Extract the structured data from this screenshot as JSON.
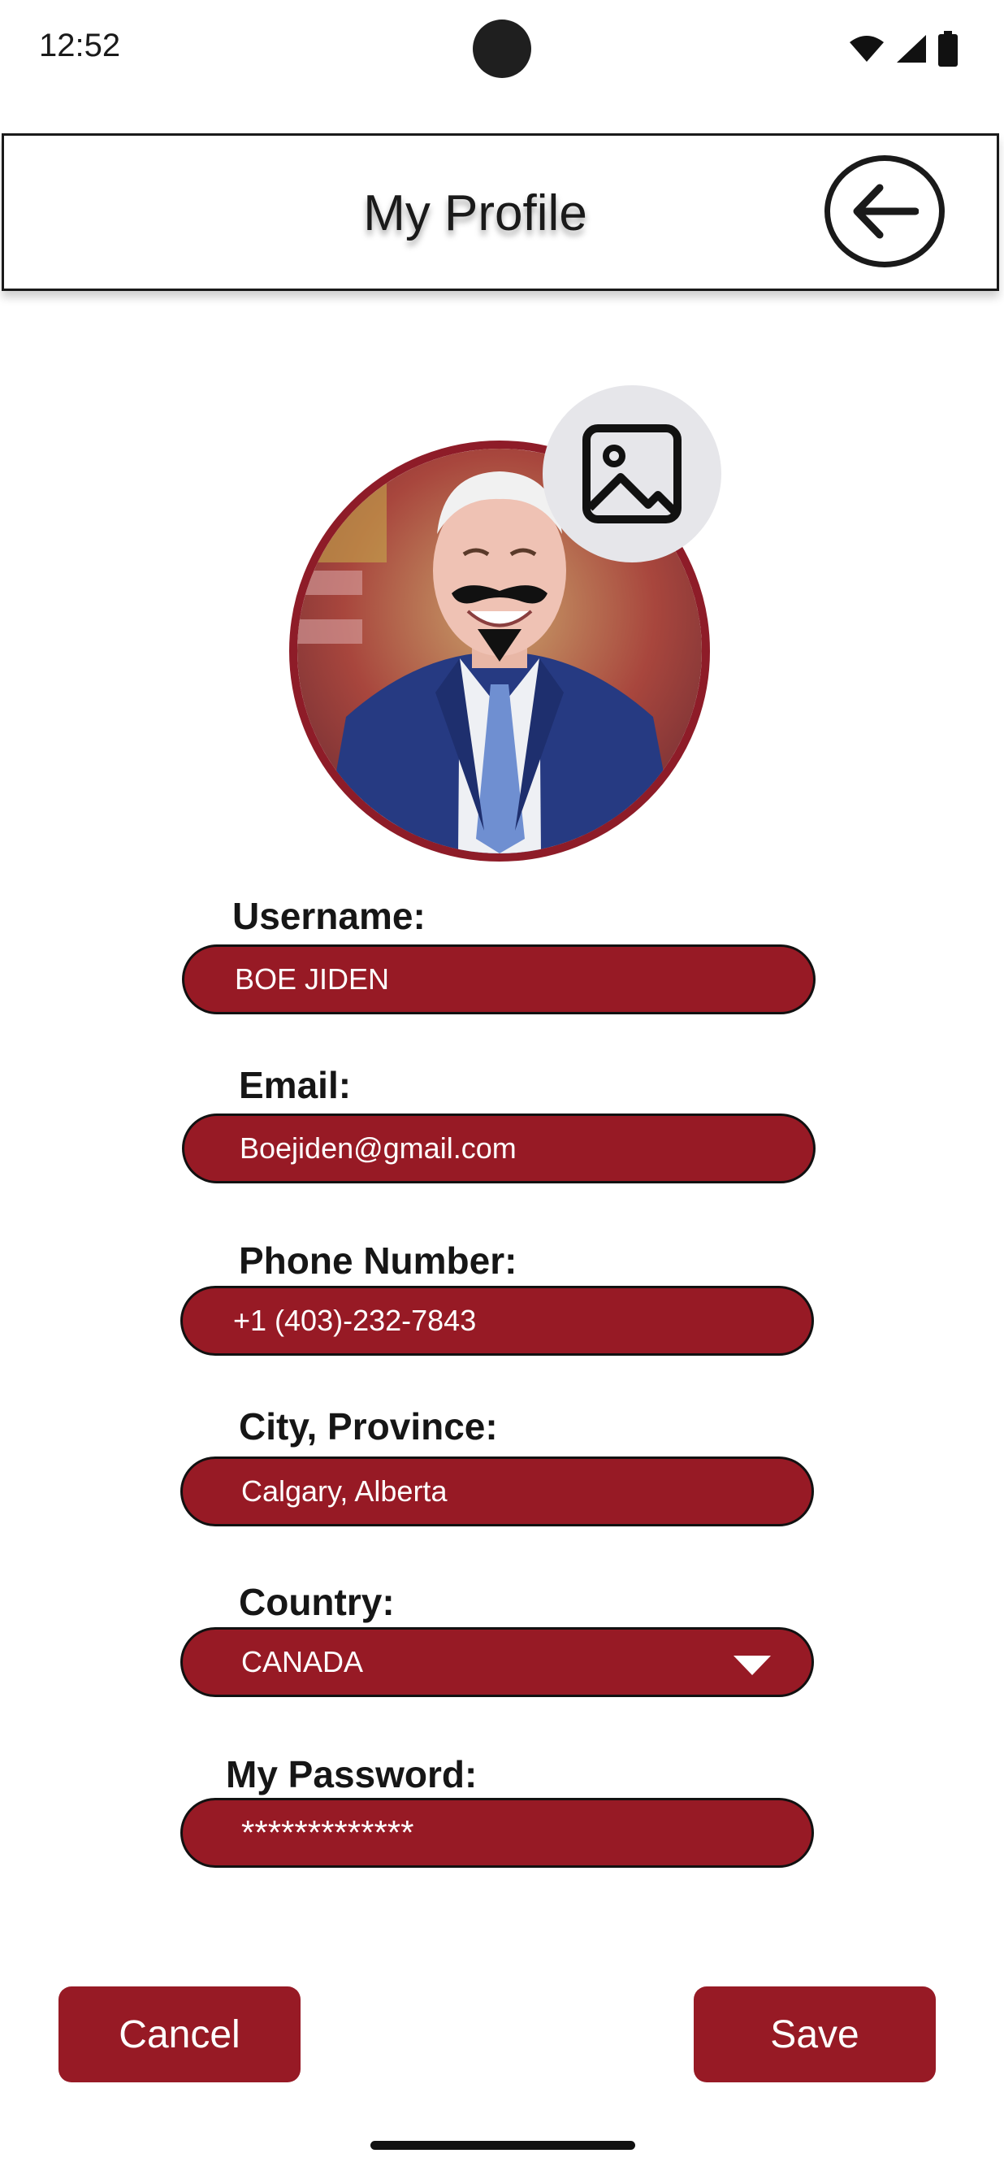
{
  "status_bar": {
    "time": "12:52",
    "icons": [
      "wifi-icon",
      "signal-icon",
      "battery-icon"
    ]
  },
  "header": {
    "title": "My Profile",
    "back_icon": "arrow-left-icon"
  },
  "avatar": {
    "change_photo_icon": "image-icon"
  },
  "form": {
    "username": {
      "label": "Username:",
      "value": "BOE JIDEN"
    },
    "email": {
      "label": "Email:",
      "value": "Boejiden@gmail.com"
    },
    "phone": {
      "label": "Phone Number:",
      "value": "+1 (403)-232-7843"
    },
    "city": {
      "label": "City, Province:",
      "value": "Calgary, Alberta"
    },
    "country": {
      "label": "Country:",
      "value": "CANADA"
    },
    "password": {
      "label": "My Password:",
      "value": "*************"
    }
  },
  "actions": {
    "cancel_label": "Cancel",
    "save_label": "Save"
  },
  "colors": {
    "accent": "#971a25",
    "avatar_border": "#8e1c28",
    "photo_button_bg": "#e6e6ea"
  }
}
